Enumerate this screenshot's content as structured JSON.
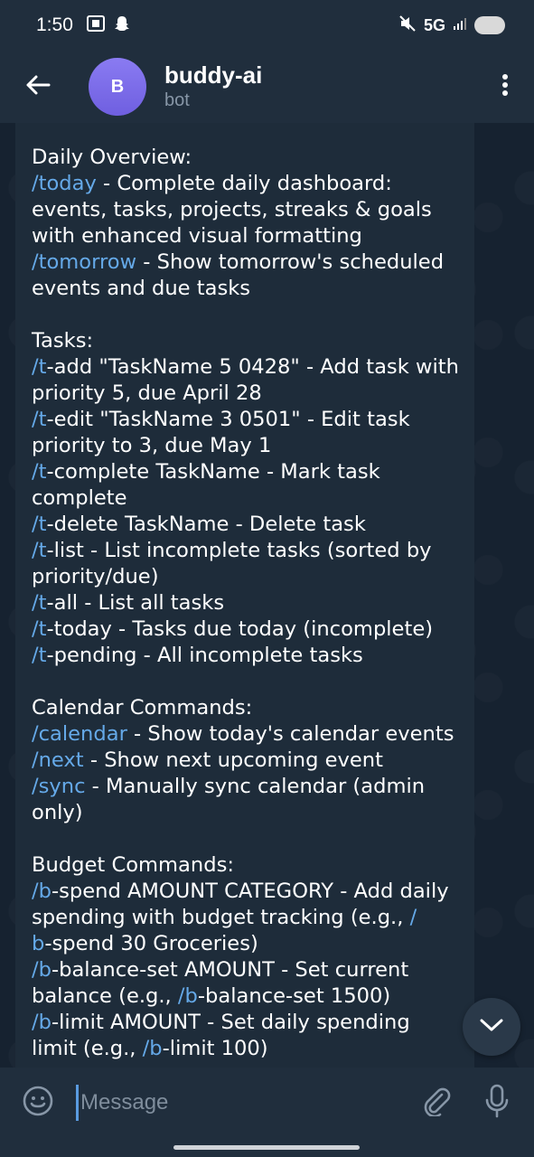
{
  "status_bar": {
    "time": "1:50",
    "network": "5G",
    "icons_left": [
      "screenshot-icon",
      "snapchat-icon"
    ],
    "icons_right": [
      "mute-icon",
      "signal-icon",
      "battery-icon"
    ]
  },
  "header": {
    "avatar_letter": "B",
    "title": "buddy-ai",
    "subtitle": "bot",
    "accent_color": "#7a6bea"
  },
  "message": {
    "link_color": "#65a9e8",
    "lines": [
      {
        "text": "Daily Overview:"
      },
      {
        "cmd": "/today",
        "text": " - Complete daily dashboard:"
      },
      {
        "text": "events, tasks, projects, streaks & goals"
      },
      {
        "text": "with enhanced visual formatting"
      },
      {
        "cmd": "/tomorrow",
        "text": " - Show tomorrow's scheduled"
      },
      {
        "text": "events and due tasks"
      },
      {
        "blank": true
      },
      {
        "text": "Tasks:"
      },
      {
        "cmd": "/t",
        "text": "-add \"TaskName 5 0428\" - Add task with"
      },
      {
        "text": "priority 5, due April 28"
      },
      {
        "cmd": "/t",
        "text": "-edit \"TaskName 3 0501\" - Edit task"
      },
      {
        "text": "priority to 3, due May 1"
      },
      {
        "cmd": "/t",
        "text": "-complete TaskName - Mark task"
      },
      {
        "text": "complete"
      },
      {
        "cmd": "/t",
        "text": "-delete TaskName - Delete task"
      },
      {
        "cmd": "/t",
        "text": "-list - List incomplete tasks (sorted by"
      },
      {
        "text": "priority/due)"
      },
      {
        "cmd": "/t",
        "text": "-all - List all tasks"
      },
      {
        "cmd": "/t",
        "text": "-today - Tasks due today (incomplete)"
      },
      {
        "cmd": "/t",
        "text": "-pending - All incomplete tasks"
      },
      {
        "blank": true
      },
      {
        "text": "Calendar Commands:"
      },
      {
        "cmd": "/calendar",
        "text": " - Show today's calendar events"
      },
      {
        "cmd": "/next",
        "text": " - Show next upcoming event"
      },
      {
        "cmd": "/sync",
        "text": " - Manually sync calendar (admin"
      },
      {
        "text": "only)"
      },
      {
        "blank": true
      },
      {
        "text": "Budget Commands:"
      },
      {
        "cmd": "/b",
        "text": "-spend AMOUNT CATEGORY - Add daily"
      },
      {
        "text": "spending with budget tracking (e.g., ",
        "cmd_after": "/"
      },
      {
        "cmd": "b",
        "text": "-spend 30 Groceries)"
      },
      {
        "cmd": "/b",
        "text": "-balance-set AMOUNT - Set current"
      },
      {
        "text": "balance (e.g., ",
        "cmd_after": "/b",
        "text_after": "-balance-set 1500)"
      },
      {
        "cmd": "/b",
        "text": "-limit AMOUNT - Set daily spending"
      },
      {
        "text": "limit (e.g., ",
        "cmd_after": "/b",
        "text_after": "-limit 100)"
      }
    ]
  },
  "input": {
    "placeholder": "Message"
  }
}
